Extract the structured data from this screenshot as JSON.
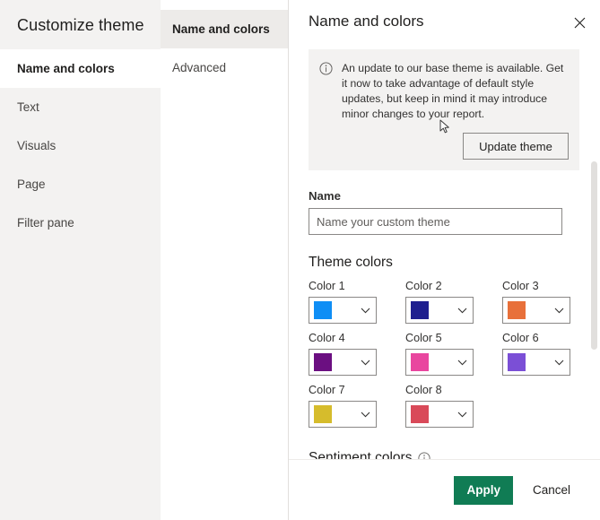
{
  "dialog": {
    "title": "Customize theme"
  },
  "sidebar": {
    "items": [
      {
        "label": "Name and colors",
        "selected": true
      },
      {
        "label": "Text",
        "selected": false
      },
      {
        "label": "Visuals",
        "selected": false
      },
      {
        "label": "Page",
        "selected": false
      },
      {
        "label": "Filter pane",
        "selected": false
      }
    ]
  },
  "tabs": {
    "items": [
      {
        "label": "Name and colors",
        "selected": true
      },
      {
        "label": "Advanced",
        "selected": false
      }
    ]
  },
  "panel": {
    "title": "Name and colors",
    "close_icon": "close-icon"
  },
  "message_bar": {
    "icon": "info-icon",
    "text": "An update to our base theme is available. Get it now to take advantage of default style updates, but keep in mind it may introduce minor changes to your report.",
    "action_label": "Update theme",
    "background": "#f3f2f1"
  },
  "name_field": {
    "label": "Name",
    "value": "",
    "placeholder": "Name your custom theme"
  },
  "theme_colors": {
    "heading": "Theme colors",
    "swatches": [
      {
        "label": "Color 1",
        "color": "#0f8ef5"
      },
      {
        "label": "Color 2",
        "color": "#1f1f8f"
      },
      {
        "label": "Color 3",
        "color": "#e8703a"
      },
      {
        "label": "Color 4",
        "color": "#6b0f81"
      },
      {
        "label": "Color 5",
        "color": "#e9469f"
      },
      {
        "label": "Color 6",
        "color": "#7b4fd6"
      },
      {
        "label": "Color 7",
        "color": "#d6bc2c"
      },
      {
        "label": "Color 8",
        "color": "#d94a59"
      }
    ],
    "chevron_icon": "chevron-down-icon"
  },
  "sentiment": {
    "label": "Sentiment colors",
    "info_icon": "info-icon"
  },
  "footer": {
    "apply_label": "Apply",
    "cancel_label": "Cancel",
    "apply_color": "#107c54"
  },
  "cursor": {
    "icon": "mouse-pointer-icon"
  }
}
